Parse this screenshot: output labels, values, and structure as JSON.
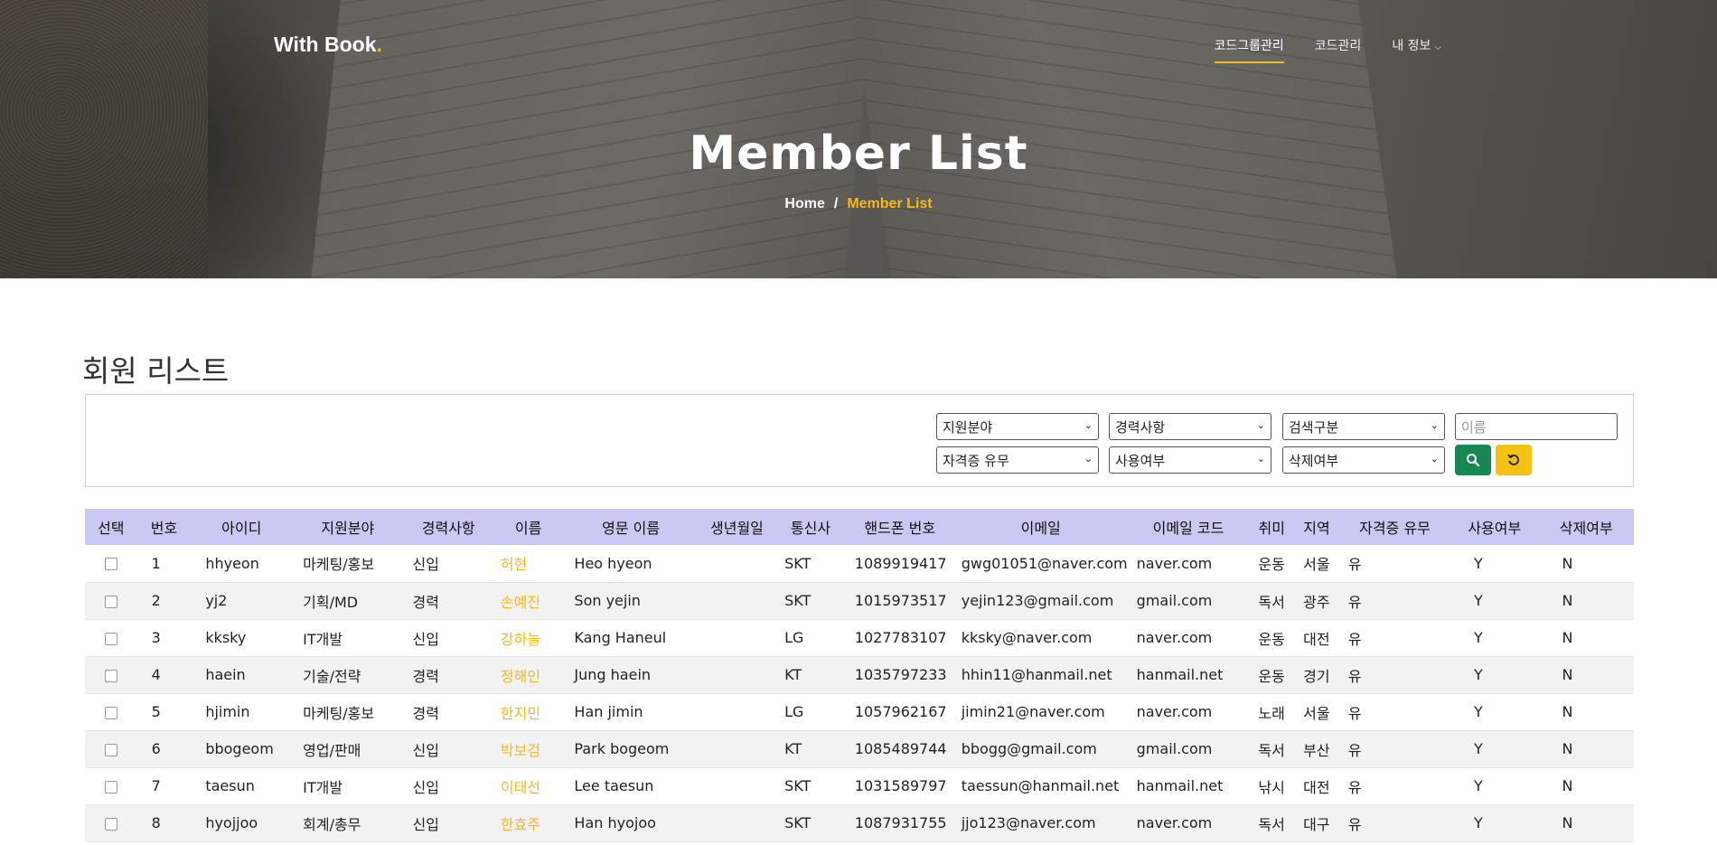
{
  "header": {
    "brand": "With Book",
    "brand_dot": ".",
    "nav": [
      {
        "label": "코드그룹관리",
        "active": true
      },
      {
        "label": "코드관리",
        "active": false
      },
      {
        "label": "내 정보",
        "active": false
      }
    ],
    "title": "Member List",
    "breadcrumb": {
      "home": "Home",
      "separator": "/",
      "current": "Member List"
    }
  },
  "section": {
    "title": "회원 리스트"
  },
  "filters": {
    "row1": {
      "field": "지원분야",
      "career": "경력사항",
      "search_type": "검색구분",
      "name_placeholder": "이름"
    },
    "row2": {
      "cert": "자격증 유무",
      "use": "사용여부",
      "delete": "삭제여부"
    }
  },
  "table": {
    "headers": [
      "선택",
      "번호",
      "아이디",
      "지원분야",
      "경력사항",
      "이름",
      "영문 이름",
      "생년월일",
      "통신사",
      "핸드폰 번호",
      "이메일",
      "이메일 코드",
      "취미",
      "지역",
      "자격증 유무",
      "사용여부",
      "삭제여부"
    ],
    "rows": [
      {
        "no": "1",
        "id": "hhyeon",
        "field": "마케팅/홍보",
        "career": "신입",
        "name": "허현",
        "ename": "Heo hyeon",
        "birth": "",
        "carrier": "SKT",
        "phone": "1089919417",
        "email": "gwg01051@naver.com",
        "ecode": "naver.com",
        "hobby": "운동",
        "region": "서울",
        "cert": "유",
        "use": "Y",
        "del": "N"
      },
      {
        "no": "2",
        "id": "yj2",
        "field": "기획/MD",
        "career": "경력",
        "name": "손예진",
        "ename": "Son yejin",
        "birth": "",
        "carrier": "SKT",
        "phone": "1015973517",
        "email": "yejin123@gmail.com",
        "ecode": "gmail.com",
        "hobby": "독서",
        "region": "광주",
        "cert": "유",
        "use": "Y",
        "del": "N"
      },
      {
        "no": "3",
        "id": "kksky",
        "field": "IT개발",
        "career": "신입",
        "name": "강하늘",
        "ename": "Kang Haneul",
        "birth": "",
        "carrier": "LG",
        "phone": "1027783107",
        "email": "kksky@naver.com",
        "ecode": "naver.com",
        "hobby": "운동",
        "region": "대전",
        "cert": "유",
        "use": "Y",
        "del": "N"
      },
      {
        "no": "4",
        "id": "haein",
        "field": "기술/전략",
        "career": "경력",
        "name": "정해인",
        "ename": "Jung haein",
        "birth": "",
        "carrier": "KT",
        "phone": "1035797233",
        "email": "hhin11@hanmail.net",
        "ecode": "hanmail.net",
        "hobby": "운동",
        "region": "경기",
        "cert": "유",
        "use": "Y",
        "del": "N"
      },
      {
        "no": "5",
        "id": "hjimin",
        "field": "마케팅/홍보",
        "career": "경력",
        "name": "한지민",
        "ename": "Han jimin",
        "birth": "",
        "carrier": "LG",
        "phone": "1057962167",
        "email": "jimin21@naver.com",
        "ecode": "naver.com",
        "hobby": "노래",
        "region": "서울",
        "cert": "유",
        "use": "Y",
        "del": "N"
      },
      {
        "no": "6",
        "id": "bbogeom",
        "field": "영업/판매",
        "career": "신입",
        "name": "박보검",
        "ename": "Park bogeom",
        "birth": "",
        "carrier": "KT",
        "phone": "1085489744",
        "email": "bbogg@gmail.com",
        "ecode": "gmail.com",
        "hobby": "독서",
        "region": "부산",
        "cert": "유",
        "use": "Y",
        "del": "N"
      },
      {
        "no": "7",
        "id": "taesun",
        "field": "IT개발",
        "career": "신입",
        "name": "이태선",
        "ename": "Lee taesun",
        "birth": "",
        "carrier": "SKT",
        "phone": "1031589797",
        "email": "taessun@hanmail.net",
        "ecode": "hanmail.net",
        "hobby": "낚시",
        "region": "대전",
        "cert": "유",
        "use": "Y",
        "del": "N"
      },
      {
        "no": "8",
        "id": "hyojjoo",
        "field": "회계/총무",
        "career": "신입",
        "name": "한효주",
        "ename": "Han hyojoo",
        "birth": "",
        "carrier": "SKT",
        "phone": "1087931755",
        "email": "jjo123@naver.com",
        "ecode": "naver.com",
        "hobby": "독서",
        "region": "대구",
        "cert": "유",
        "use": "Y",
        "del": "N"
      }
    ]
  },
  "colors": {
    "accent": "#f5b91e",
    "header_bg": "#c9c8f1",
    "search_btn": "#198754",
    "reset_btn": "#f5c211"
  },
  "icons": {
    "search": "search-icon",
    "reset": "reset-icon",
    "nav_dropdown": "chevron-down-icon"
  }
}
